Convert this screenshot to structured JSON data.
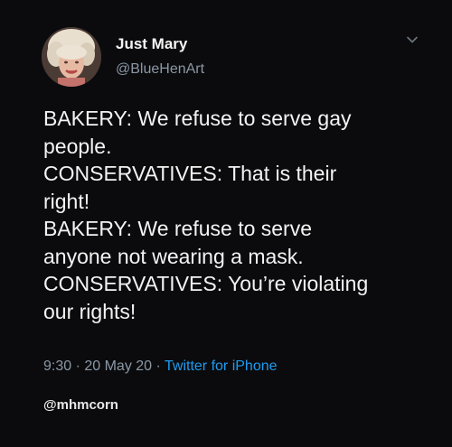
{
  "author": {
    "display_name": "Just Mary",
    "handle": "@BlueHenArt",
    "avatar": "profile-photo"
  },
  "tweet": {
    "lines": [
      "BAKERY: We refuse to serve gay",
      "people.",
      "CONSERVATIVES: That is their",
      "right!",
      "BAKERY: We refuse to serve",
      "anyone not wearing a mask.",
      "CONSERVATIVES: You’re violating",
      "our rights!"
    ],
    "time": "9:30",
    "separator_1": " · ",
    "date": "20 May 20",
    "separator_2": " · ",
    "source": "Twitter for iPhone"
  },
  "watermark": "@mhmcorn",
  "icons": {
    "menu": "chevron-down-icon"
  },
  "colors": {
    "background": "#0b0b0d",
    "text": "#f3f3f3",
    "secondary_text": "#8b98a5",
    "link": "#1d9bf0"
  }
}
